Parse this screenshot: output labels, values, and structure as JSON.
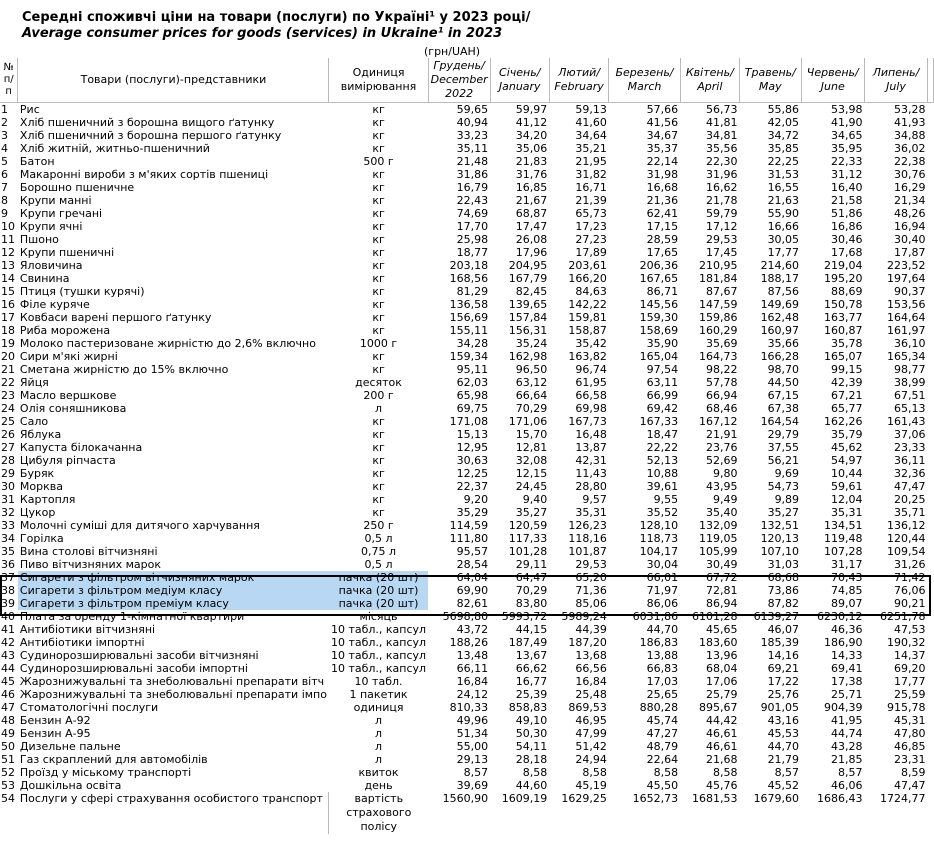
{
  "title_ua": "Середні споживчі ціни на товари (послуги) по Україні¹ у 2023 році/",
  "title_en": "Average consumer prices for goods (services) in Ukraine¹ in 2023",
  "unit_note": "(грн/UAH)",
  "headers": {
    "no": "№ п/п",
    "name": "Товари (послуги)-представники",
    "unit": "Одиниця вимірювання",
    "dec": "Грудень/ December 2022",
    "jan": "Січень/ January",
    "feb": "Лютий/ February",
    "mar": "Березень/ March",
    "apr": "Квітень/ April",
    "may": "Травень/ May",
    "jun": "Червень/ June",
    "jul": "Липень/ July"
  },
  "rows": [
    [
      "1",
      "Рис",
      "кг",
      "59,65",
      "59,97",
      "59,13",
      "57,66",
      "56,73",
      "55,86",
      "53,98",
      "53,28"
    ],
    [
      "2",
      "Хліб пшеничний з борошна вищого ґатунку",
      "кг",
      "40,94",
      "41,12",
      "41,60",
      "41,56",
      "41,81",
      "42,05",
      "41,90",
      "41,93"
    ],
    [
      "3",
      "Хліб пшеничний з борошна першого ґатунку",
      "кг",
      "33,23",
      "34,20",
      "34,64",
      "34,67",
      "34,81",
      "34,72",
      "34,65",
      "34,88"
    ],
    [
      "4",
      "Хліб житній, житньо-пшеничний",
      "кг",
      "35,11",
      "35,06",
      "35,21",
      "35,37",
      "35,56",
      "35,85",
      "35,95",
      "36,02"
    ],
    [
      "5",
      "Батон",
      "500 г",
      "21,48",
      "21,83",
      "21,95",
      "22,14",
      "22,30",
      "22,25",
      "22,33",
      "22,38"
    ],
    [
      "6",
      "Макаронні вироби з м'яких сортів пшениці",
      "кг",
      "31,86",
      "31,76",
      "31,82",
      "31,98",
      "31,96",
      "31,53",
      "31,12",
      "30,76"
    ],
    [
      "7",
      "Борошно пшеничне",
      "кг",
      "16,79",
      "16,85",
      "16,71",
      "16,68",
      "16,62",
      "16,55",
      "16,40",
      "16,29"
    ],
    [
      "8",
      "Крупи манні",
      "кг",
      "22,43",
      "21,67",
      "21,39",
      "21,36",
      "21,78",
      "21,63",
      "21,58",
      "21,34"
    ],
    [
      "9",
      "Крупи гречані",
      "кг",
      "74,69",
      "68,87",
      "65,73",
      "62,41",
      "59,79",
      "55,90",
      "51,86",
      "48,26"
    ],
    [
      "10",
      "Крупи ячні",
      "кг",
      "17,70",
      "17,47",
      "17,23",
      "17,15",
      "17,12",
      "16,66",
      "16,86",
      "16,94"
    ],
    [
      "11",
      "Пшоно",
      "кг",
      "25,98",
      "26,08",
      "27,23",
      "28,59",
      "29,53",
      "30,05",
      "30,46",
      "30,40"
    ],
    [
      "12",
      "Крупи пшеничні",
      "кг",
      "18,77",
      "17,96",
      "17,89",
      "17,65",
      "17,45",
      "17,77",
      "17,68",
      "17,87"
    ],
    [
      "13",
      "Яловичина",
      "кг",
      "203,18",
      "204,95",
      "203,61",
      "206,36",
      "210,95",
      "214,60",
      "219,04",
      "223,52"
    ],
    [
      "14",
      "Свинина",
      "кг",
      "168,56",
      "167,79",
      "166,20",
      "167,65",
      "181,84",
      "188,17",
      "195,20",
      "197,64"
    ],
    [
      "15",
      "Птиця (тушки курячі)",
      "кг",
      "81,29",
      "82,45",
      "84,63",
      "86,71",
      "87,67",
      "87,56",
      "88,69",
      "90,37"
    ],
    [
      "16",
      "Філе куряче",
      "кг",
      "136,58",
      "139,65",
      "142,22",
      "145,56",
      "147,59",
      "149,69",
      "150,78",
      "153,56"
    ],
    [
      "17",
      "Ковбаси варені першого ґатунку",
      "кг",
      "156,69",
      "157,84",
      "159,81",
      "159,30",
      "159,86",
      "162,48",
      "163,77",
      "164,64"
    ],
    [
      "18",
      "Риба морожена",
      "кг",
      "155,11",
      "156,31",
      "158,87",
      "158,69",
      "160,29",
      "160,97",
      "160,87",
      "161,97"
    ],
    [
      "19",
      "Молоко пастеризоване жирністю до 2,6% включно",
      "1000 г",
      "34,28",
      "35,24",
      "35,42",
      "35,90",
      "35,69",
      "35,66",
      "35,78",
      "36,10"
    ],
    [
      "20",
      "Сири м'які жирні",
      "кг",
      "159,34",
      "162,98",
      "163,82",
      "165,04",
      "164,73",
      "166,28",
      "165,07",
      "165,34"
    ],
    [
      "21",
      "Сметана жирністю до 15% включно",
      "кг",
      "95,11",
      "96,50",
      "96,74",
      "97,54",
      "98,22",
      "98,70",
      "99,15",
      "98,77"
    ],
    [
      "22",
      "Яйця",
      "десяток",
      "62,03",
      "63,12",
      "61,95",
      "63,11",
      "57,78",
      "44,50",
      "42,39",
      "38,99"
    ],
    [
      "23",
      "Масло вершкове",
      "200 г",
      "65,98",
      "66,64",
      "66,58",
      "66,99",
      "66,94",
      "67,15",
      "67,21",
      "67,51"
    ],
    [
      "24",
      "Олія соняшникова",
      "л",
      "69,75",
      "70,29",
      "69,98",
      "69,42",
      "68,46",
      "67,38",
      "65,77",
      "65,13"
    ],
    [
      "25",
      "Сало",
      "кг",
      "171,08",
      "171,06",
      "167,73",
      "167,33",
      "167,12",
      "164,54",
      "162,26",
      "161,43"
    ],
    [
      "26",
      "Яблука",
      "кг",
      "15,13",
      "15,70",
      "16,48",
      "18,47",
      "21,91",
      "29,79",
      "35,79",
      "37,06"
    ],
    [
      "27",
      "Капуста білокачанна",
      "кг",
      "12,95",
      "12,81",
      "13,87",
      "22,22",
      "23,76",
      "37,55",
      "45,62",
      "23,33"
    ],
    [
      "28",
      "Цибуля ріпчаста",
      "кг",
      "30,63",
      "32,08",
      "42,31",
      "52,13",
      "52,69",
      "56,21",
      "54,97",
      "36,11"
    ],
    [
      "29",
      "Буряк",
      "кг",
      "12,25",
      "12,15",
      "11,43",
      "10,88",
      "9,80",
      "9,69",
      "10,44",
      "32,36"
    ],
    [
      "30",
      "Морква",
      "кг",
      "22,37",
      "24,45",
      "28,80",
      "39,61",
      "43,95",
      "54,73",
      "59,61",
      "47,47"
    ],
    [
      "31",
      "Картопля",
      "кг",
      "9,20",
      "9,40",
      "9,57",
      "9,55",
      "9,49",
      "9,89",
      "12,04",
      "20,25"
    ],
    [
      "32",
      "Цукор",
      "кг",
      "35,29",
      "35,27",
      "35,31",
      "35,52",
      "35,40",
      "35,27",
      "35,31",
      "35,71"
    ],
    [
      "33",
      "Молочні суміші для дитячого харчування",
      "250 г",
      "114,59",
      "120,59",
      "126,23",
      "128,10",
      "132,09",
      "132,51",
      "134,51",
      "136,12"
    ],
    [
      "34",
      "Горілка",
      "0,5 л",
      "111,80",
      "117,33",
      "118,16",
      "118,73",
      "119,05",
      "120,13",
      "119,48",
      "120,44"
    ],
    [
      "35",
      "Вина столові вітчизняні",
      "0,75 л",
      "95,57",
      "101,28",
      "101,87",
      "104,17",
      "105,99",
      "107,10",
      "107,28",
      "109,54"
    ],
    [
      "36",
      "Пиво вітчизняних марок",
      "0,5 л",
      "28,54",
      "29,11",
      "29,53",
      "30,04",
      "30,49",
      "31,03",
      "31,17",
      "31,26"
    ],
    [
      "37",
      "Сигарети з фільтром вітчизняних марок",
      "пачка (20 шт)",
      "64,04",
      "64,47",
      "65,20",
      "66,01",
      "67,72",
      "68,68",
      "70,43",
      "71,42"
    ],
    [
      "38",
      "Сигарети з фільтром медіум класу",
      "пачка (20 шт)",
      "69,90",
      "70,29",
      "71,36",
      "71,97",
      "72,81",
      "73,86",
      "74,85",
      "76,06"
    ],
    [
      "39",
      "Сигарети з фільтром преміум класу",
      "пачка (20 шт)",
      "82,61",
      "83,80",
      "85,06",
      "86,06",
      "86,94",
      "87,82",
      "89,07",
      "90,21"
    ],
    [
      "40",
      "Плата за оренду 1-кімнатної квартири",
      "місяць",
      "5698,80",
      "5993,72",
      "5989,24",
      "6031,86",
      "6101,28",
      "6139,27",
      "6230,12",
      "6251,78"
    ],
    [
      "41",
      "Антибіотики вітчизняні",
      "10 табл., капсул",
      "43,72",
      "44,15",
      "44,39",
      "44,70",
      "45,65",
      "46,07",
      "46,36",
      "47,53"
    ],
    [
      "42",
      "Антибіотики імпортні",
      "10 табл., капсул",
      "188,26",
      "187,49",
      "187,20",
      "186,83",
      "183,60",
      "185,39",
      "186,90",
      "190,32"
    ],
    [
      "43",
      "Судинорозширювальні засоби вітчизняні",
      "10 табл., капсул",
      "13,48",
      "13,67",
      "13,68",
      "13,88",
      "13,96",
      "14,16",
      "14,33",
      "14,37"
    ],
    [
      "44",
      "Судинорозширювальні засоби імпортні",
      "10 табл., капсул",
      "66,11",
      "66,62",
      "66,56",
      "66,83",
      "68,04",
      "69,21",
      "69,41",
      "69,20"
    ],
    [
      "45",
      "Жарознижувальні та знеболювальні препарати вітч",
      "10 табл.",
      "16,84",
      "16,77",
      "16,84",
      "17,03",
      "17,06",
      "17,22",
      "17,38",
      "17,77"
    ],
    [
      "46",
      "Жарознижувальні та знеболювальні препарати імпо",
      "1 пакетик",
      "24,12",
      "25,39",
      "25,48",
      "25,65",
      "25,79",
      "25,76",
      "25,71",
      "25,59"
    ],
    [
      "47",
      "Стоматологічні послуги",
      "одиниця",
      "810,33",
      "858,83",
      "869,53",
      "880,28",
      "895,67",
      "901,05",
      "904,39",
      "915,78"
    ],
    [
      "48",
      "Бензин А-92",
      "л",
      "49,96",
      "49,10",
      "46,95",
      "45,74",
      "44,42",
      "43,16",
      "41,95",
      "45,31"
    ],
    [
      "49",
      "Бензин А-95",
      "л",
      "51,34",
      "50,30",
      "47,99",
      "47,27",
      "46,61",
      "45,53",
      "44,74",
      "47,80"
    ],
    [
      "50",
      "Дизельне пальне",
      "л",
      "55,00",
      "54,11",
      "51,42",
      "48,79",
      "46,61",
      "44,70",
      "43,28",
      "46,85"
    ],
    [
      "51",
      "Газ скраплений для автомобілів",
      "л",
      "29,13",
      "28,18",
      "24,94",
      "22,64",
      "21,68",
      "21,79",
      "21,85",
      "23,31"
    ],
    [
      "52",
      "Проїзд у міському транспорті",
      "квиток",
      "8,57",
      "8,58",
      "8,58",
      "8,58",
      "8,58",
      "8,57",
      "8,57",
      "8,59"
    ],
    [
      "53",
      "Дошкільна освіта",
      "день",
      "39,69",
      "44,60",
      "45,19",
      "45,50",
      "45,76",
      "45,52",
      "46,06",
      "47,47"
    ],
    [
      "54",
      "Послуги у сфері страхування особистого транспорт",
      "вартість страхового полісу",
      "1560,90",
      "1609,19",
      "1629,25",
      "1652,73",
      "1681,53",
      "1679,60",
      "1686,43",
      "1724,77"
    ]
  ]
}
